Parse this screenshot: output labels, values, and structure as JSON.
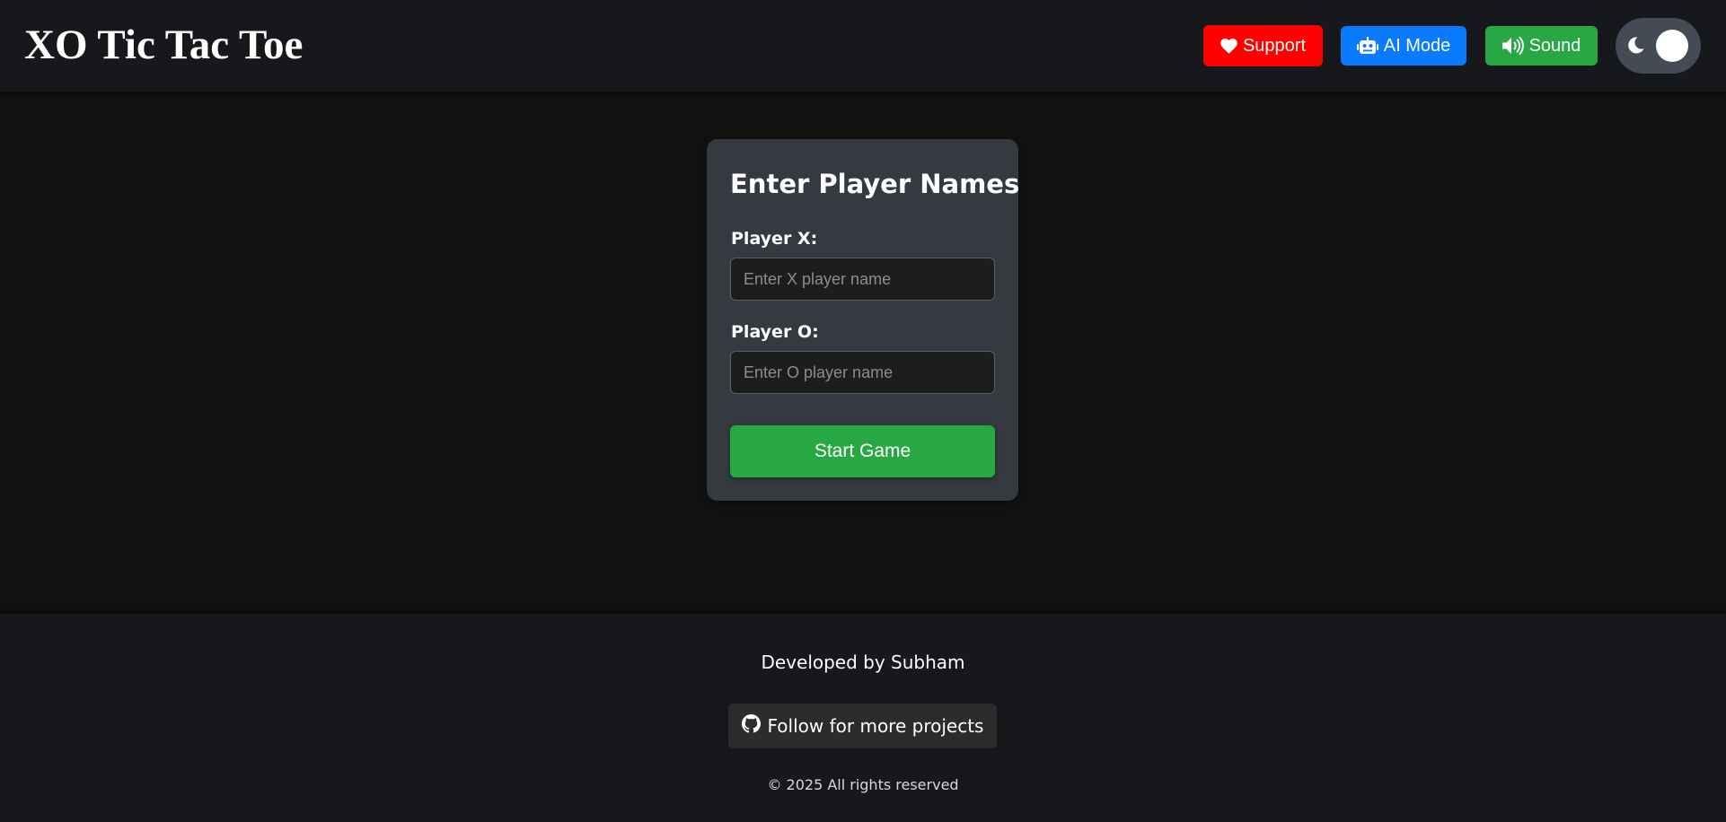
{
  "header": {
    "title": "XO Tic Tac Toe",
    "buttons": {
      "support": {
        "label": "Support",
        "icon": "heart-icon",
        "color": "#ff0000"
      },
      "ai_mode": {
        "label": "AI Mode",
        "icon": "robot-icon",
        "color": "#0a7bff"
      },
      "sound": {
        "label": "Sound",
        "icon": "volume-icon",
        "color": "#28a745"
      }
    },
    "theme_toggle": {
      "icon": "moon-icon",
      "state": "dark"
    }
  },
  "setup_card": {
    "title": "Enter Player Names",
    "player_x": {
      "label": "Player X:",
      "value": "",
      "placeholder": "Enter X player name"
    },
    "player_o": {
      "label": "Player O:",
      "value": "",
      "placeholder": "Enter O player name"
    },
    "start_label": "Start Game",
    "start_color": "#28a745"
  },
  "footer": {
    "developer": "Developed by Subham",
    "follow_label": "Follow for more projects",
    "follow_icon": "github-icon",
    "copyright": "© 2025 All rights reserved"
  }
}
